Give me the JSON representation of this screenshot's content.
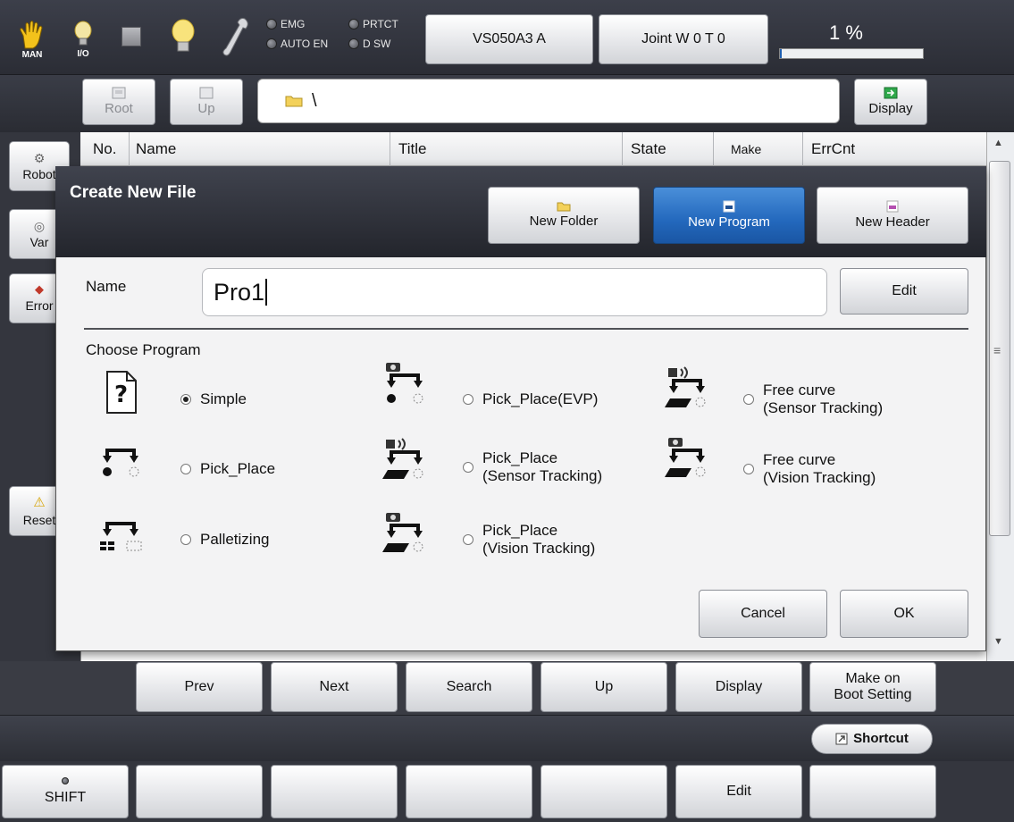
{
  "topbar": {
    "man_label": "MAN",
    "io_label": "I/O",
    "lamps": [
      "EMG",
      "PRTCT",
      "AUTO EN",
      "D SW"
    ],
    "robot_name": "VS050A3 A",
    "joint_label": "Joint  W 0 T 0",
    "speed_text": "1 %",
    "speed_fraction": 0.01
  },
  "pathbar": {
    "root_label": "Root",
    "up_label": "Up",
    "path": "\\",
    "display_label": "Display"
  },
  "list": {
    "columns": [
      "No.",
      "Name",
      "Title",
      "State",
      "Make",
      "ErrCnt"
    ]
  },
  "sidebar": {
    "items": [
      "Robot",
      "Var",
      "Error",
      "Reset"
    ]
  },
  "dialog": {
    "title": "Create New File",
    "new_folder": "New Folder",
    "new_program": "New Program",
    "new_header": "New Header",
    "name_label": "Name",
    "name_value": "Pro1",
    "edit_label": "Edit",
    "choose_label": "Choose Program",
    "options": [
      {
        "line1": "Simple",
        "line2": "",
        "selected": true
      },
      {
        "line1": "Pick_Place(EVP)",
        "line2": "",
        "selected": false
      },
      {
        "line1": "Free curve",
        "line2": "(Sensor Tracking)",
        "selected": false
      },
      {
        "line1": "Pick_Place",
        "line2": "",
        "selected": false
      },
      {
        "line1": "Pick_Place",
        "line2": "(Sensor Tracking)",
        "selected": false
      },
      {
        "line1": "Free curve",
        "line2": "(Vision Tracking)",
        "selected": false
      },
      {
        "line1": "Palletizing",
        "line2": "",
        "selected": false
      },
      {
        "line1": "Pick_Place",
        "line2": "(Vision Tracking)",
        "selected": false
      }
    ],
    "cancel_label": "Cancel",
    "ok_label": "OK"
  },
  "functions": {
    "prev": "Prev",
    "next": "Next",
    "search": "Search",
    "up": "Up",
    "display": "Display",
    "make_on_boot_1": "Make on",
    "make_on_boot_2": "Boot Setting"
  },
  "shortcut_label": "Shortcut",
  "bottom": {
    "shift": "SHIFT",
    "edit": "Edit"
  }
}
